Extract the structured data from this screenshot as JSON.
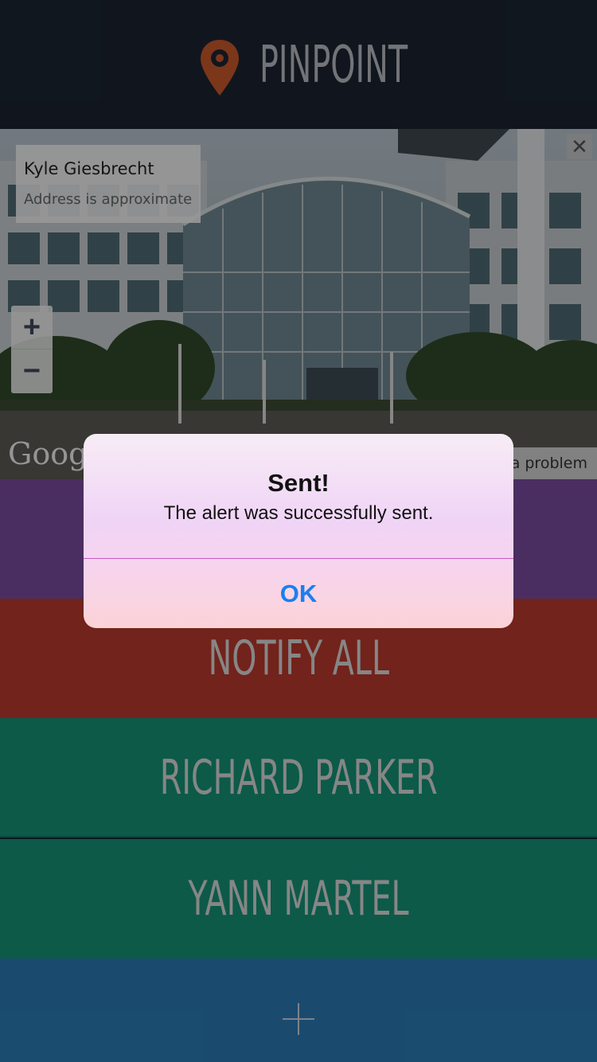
{
  "header": {
    "title": "PINPOINT",
    "logo_icon": "location-pin-icon",
    "logo_color": "#c8572a"
  },
  "street_view": {
    "person_name": "Kyle Giesbrecht",
    "address_note": "Address is approximate",
    "close_label": "✕",
    "zoom_in_label": "+",
    "zoom_out_label": "−",
    "google_logo": "Goog",
    "report_text": "a problem"
  },
  "actions": [
    {
      "label": "",
      "color": "#7a4b9d"
    },
    {
      "label": "NOTIFY ALL",
      "color": "#b8392c"
    },
    {
      "label": "RICHARD PARKER",
      "color": "#169276"
    },
    {
      "label": "YANN MARTEL",
      "color": "#169276"
    }
  ],
  "add_button": {
    "icon": "plus-icon",
    "color": "#2a7ab4"
  },
  "alert": {
    "title": "Sent!",
    "message": "The alert was successfully sent.",
    "ok_label": "OK"
  }
}
